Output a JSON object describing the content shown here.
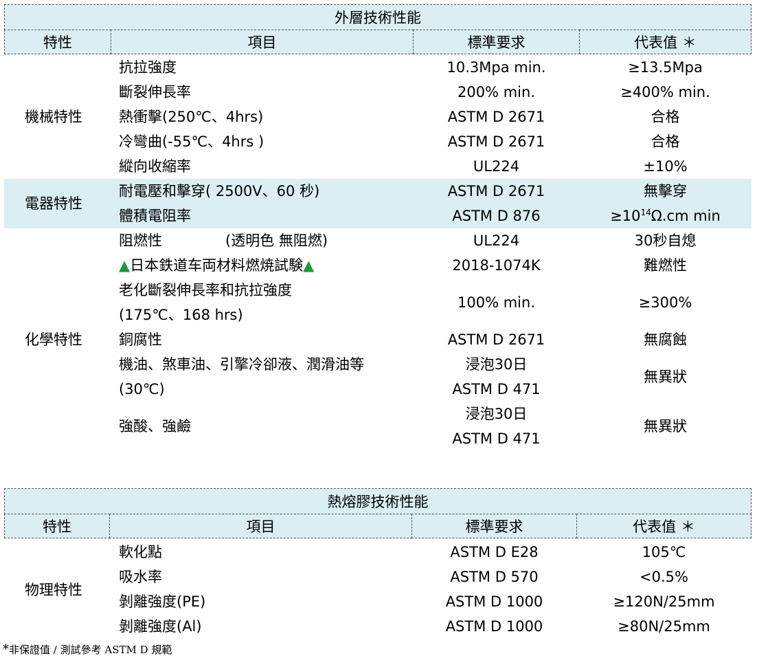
{
  "outer": {
    "title": "外層技術性能",
    "headers": [
      "特性",
      "項目",
      "標準要求",
      "代表值 ＊"
    ],
    "groups": [
      {
        "category": "機械特性"
      },
      {
        "category": "電器特性"
      },
      {
        "category": "化學特性"
      }
    ],
    "rows": [
      {
        "item": "抗拉強度",
        "standard": "10.3Mpa min.",
        "value": "≥13.5Mpa"
      },
      {
        "item": "斷裂伸長率",
        "standard": "200% min.",
        "value": "≥400% min."
      },
      {
        "item": "熱衝擊(250℃、4hrs)",
        "standard": "ASTM D 2671",
        "value": "合格"
      },
      {
        "item": "冷彎曲(-55℃、4hrs )",
        "standard": "ASTM D 2671",
        "value": "合格"
      },
      {
        "item": "縱向收縮率",
        "standard": "UL224",
        "value": "±10%"
      },
      {
        "item": "耐電壓和擊穿( 2500V、60  秒)",
        "standard": "ASTM D 2671",
        "value": "無擊穿"
      },
      {
        "item": "體積電阻率",
        "standard": "ASTM D 876",
        "value_prefix": "≥10",
        "value_sup": "14",
        "value_suffix": "Ω.cm min"
      },
      {
        "item": "阻燃性",
        "item_note": "(透明色  無阻燃)",
        "standard": "UL224",
        "value": "30秒自熄"
      },
      {
        "item_mark_left": "▲",
        "item": "日本鉄道车両材料燃焼試験",
        "item_mark_right": "▲",
        "standard": "2018-1074K",
        "value": "難燃性"
      },
      {
        "item_line1": "老化斷裂伸長率和抗拉強度",
        "item_line2": "(175℃、168 hrs)",
        "standard": "100% min.",
        "value": "≥300%"
      },
      {
        "item": "銅腐性",
        "standard": "ASTM D 2671",
        "value": "無腐蝕"
      },
      {
        "item_line1": "機油、煞車油、引擎冷卻液、潤滑油等",
        "item_line2": "(30℃)",
        "standard_line1": "浸泡30日",
        "standard_line2": "ASTM D 471",
        "value": "無異狀"
      },
      {
        "item": "強酸、強鹼",
        "standard_line1": "浸泡30日",
        "standard_line2": "ASTM D 471",
        "value": "無異狀"
      }
    ]
  },
  "hotmelt": {
    "title": "熱熔膠技術性能",
    "headers": [
      "特性",
      "項目",
      "標準要求",
      "代表值 ＊"
    ],
    "category": "物理特性",
    "rows": [
      {
        "item": "軟化點",
        "standard": "ASTM D E28",
        "value": "105℃"
      },
      {
        "item": "吸水率",
        "standard": "ASTM D 570",
        "value": "<0.5%"
      },
      {
        "item": "剝離強度(PE)",
        "standard": "ASTM D 1000",
        "value": "≥120N/25mm"
      },
      {
        "item": "剝離強度(Al)",
        "standard": "ASTM D 1000",
        "value": "≥80N/25mm"
      }
    ]
  },
  "footnote": {
    "mark": "*",
    "text": "非保證值 / 測試參考 ASTM D 規範"
  },
  "colors": {
    "header_bg": "#daeef3",
    "triangle": "#1a9a3a"
  }
}
